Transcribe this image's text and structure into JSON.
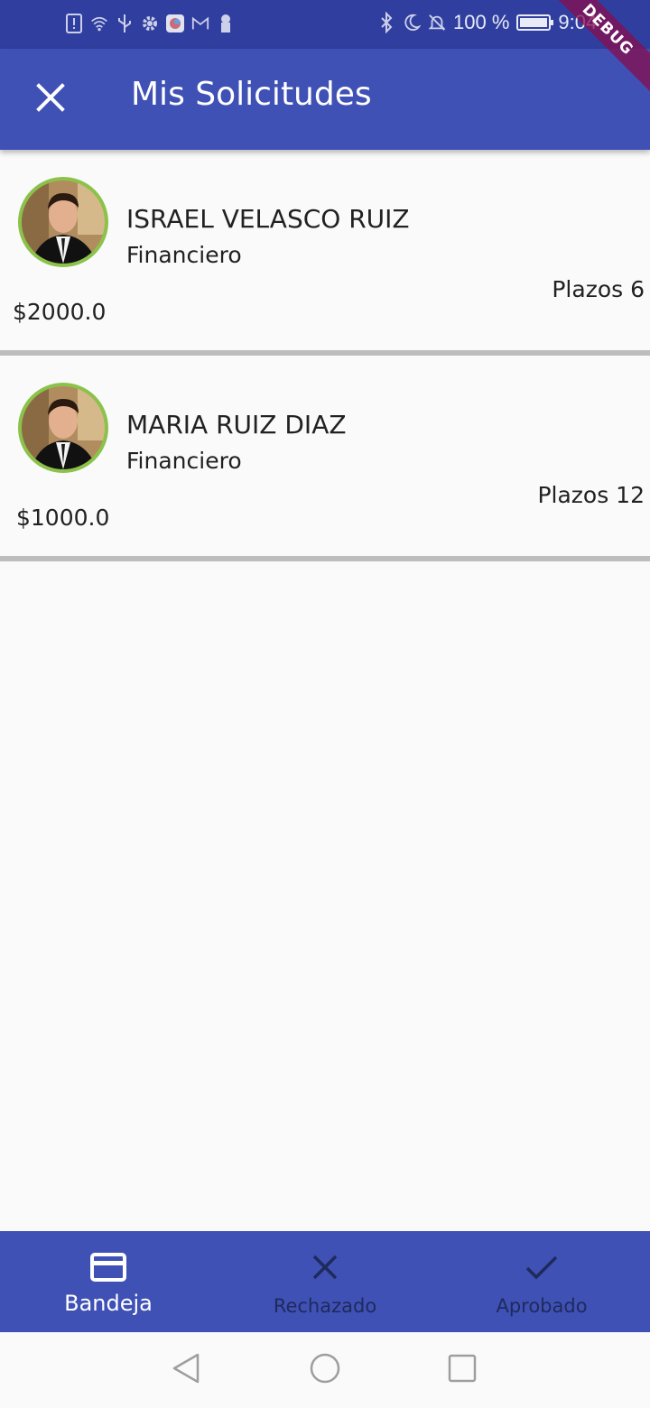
{
  "status_bar": {
    "battery_text": "100 %",
    "battery_level": 1.0,
    "time": "9:04",
    "left_icons": [
      "alert-icon",
      "wifi-icon",
      "usb-icon",
      "settings-icon",
      "app-icon",
      "gmail-icon",
      "lock-icon"
    ],
    "right_icons": [
      "bluetooth-icon",
      "moon-icon",
      "bell-off-icon"
    ]
  },
  "debug_banner": "DEBUG",
  "app_bar": {
    "title": "Mis Solicitudes",
    "close_icon": "close-icon",
    "background": "#3f51b5"
  },
  "requests": [
    {
      "name": "ISRAEL VELASCO RUIZ",
      "role": "Financiero",
      "plazos": "Plazos 6",
      "amount": "$2000.0"
    },
    {
      "name": "MARIA RUIZ DIAZ",
      "role": "Financiero",
      "plazos": "Plazos 12",
      "amount": "$1000.0"
    }
  ],
  "bottom_nav": {
    "items": [
      {
        "label": "Bandeja",
        "icon": "credit-card-icon",
        "active": true
      },
      {
        "label": "Rechazado",
        "icon": "close-icon",
        "active": false
      },
      {
        "label": "Aprobado",
        "icon": "check-icon",
        "active": false
      }
    ]
  },
  "system_nav": [
    "back-icon",
    "home-icon",
    "recents-icon"
  ],
  "colors": {
    "primary": "#3f51b5",
    "status_bar": "#303f9f",
    "avatar_ring": "#8bc34a",
    "divider": "#bdbdbd"
  }
}
